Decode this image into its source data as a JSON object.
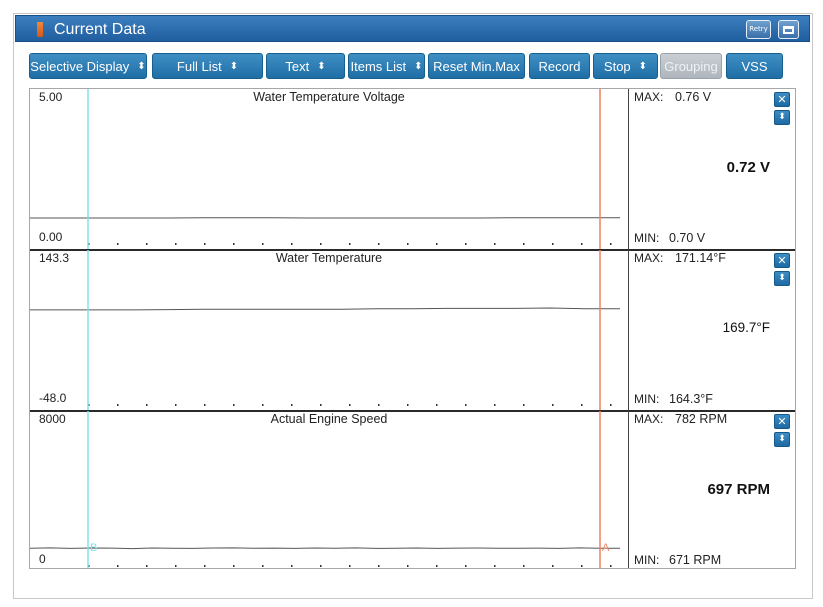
{
  "window": {
    "title": "Current Data",
    "retry_label": "Retry",
    "retry_icon": "retry-icon",
    "maximize_icon": "maximize-icon"
  },
  "toolbar": {
    "buttons": [
      {
        "label": "Selective Display",
        "has_arrows": true
      },
      {
        "label": "Full List",
        "has_arrows": true
      },
      {
        "label": "Text",
        "has_arrows": true
      },
      {
        "label": "Items List",
        "has_arrows": true
      },
      {
        "label": "Reset Min.Max",
        "has_arrows": false
      },
      {
        "label": "Record",
        "has_arrows": false
      },
      {
        "label": "Stop",
        "has_arrows": true
      },
      {
        "label": "Grouping",
        "has_arrows": false,
        "disabled": true
      },
      {
        "label": "VSS",
        "has_arrows": false
      }
    ],
    "arrow_glyph": "⬍"
  },
  "cursors": {
    "left_label": "B",
    "right_label": "A",
    "left_color": "#7fe3ea",
    "right_color": "#f08060"
  },
  "panels": [
    {
      "title": "Water Temperature Voltage",
      "y_max": "5.00",
      "y_min": "0.00",
      "max_label": "MAX:",
      "max_value": "0.76 V",
      "min_label": "MIN:",
      "min_value": "0.70 V",
      "current_value": "0.72 V",
      "range": [
        0,
        5
      ],
      "trace": [
        0.72,
        0.72,
        0.72,
        0.72,
        0.72,
        0.73,
        0.73,
        0.73,
        0.72,
        0.72,
        0.72,
        0.72,
        0.72,
        0.72,
        0.73,
        0.73,
        0.73,
        0.73
      ]
    },
    {
      "title": "Water Temperature",
      "y_max": "143.3",
      "y_min": "-48.0",
      "max_label": "MAX:",
      "max_value": "171.14°F",
      "min_label": "MIN:",
      "min_value": "164.3°F",
      "current_value": "169.7°F",
      "range": [
        -48,
        143.3
      ],
      "trace": [
        70,
        70,
        70,
        70,
        70.5,
        71,
        71,
        71,
        71,
        71,
        71.5,
        71.5,
        72,
        72,
        72,
        72.5,
        71.5,
        71.5
      ]
    },
    {
      "title": "Actual Engine Speed",
      "y_max": "8000",
      "y_min": "0",
      "max_label": "MAX:",
      "max_value": "782 RPM",
      "min_label": "MIN:",
      "min_value": "671 RPM",
      "current_value": "697 RPM",
      "range": [
        0,
        8000
      ],
      "trace": [
        700,
        720,
        690,
        710,
        705,
        680,
        715,
        700,
        690,
        710,
        720,
        695,
        705,
        690,
        710,
        700,
        720,
        690,
        700,
        710,
        690,
        705,
        715,
        695,
        700,
        705,
        690,
        720,
        700,
        697
      ]
    }
  ],
  "colors": {
    "button_blue": "#2a7db5",
    "title_blue": "#2a68a8"
  }
}
